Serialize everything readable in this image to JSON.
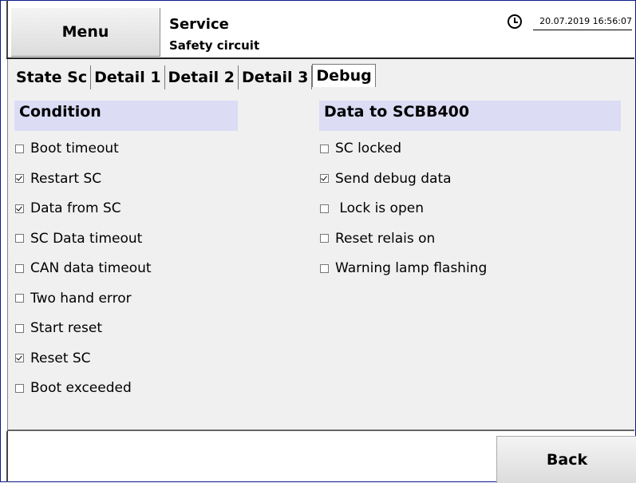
{
  "header": {
    "menu_label": "Menu",
    "title": "Service",
    "subtitle": "Safety circuit",
    "datetime": "20.07.2019   16:56:07"
  },
  "tabs": [
    {
      "label": "State Sc",
      "active": false
    },
    {
      "label": "Detail 1",
      "active": false
    },
    {
      "label": "Detail 2",
      "active": false
    },
    {
      "label": "Detail 3",
      "active": false
    },
    {
      "label": "Debug",
      "active": true
    }
  ],
  "condition": {
    "title": "Condition",
    "items": [
      {
        "label": "Boot timeout",
        "checked": false
      },
      {
        "label": "Restart SC",
        "checked": true
      },
      {
        "label": "Data from SC",
        "checked": true
      },
      {
        "label": "SC Data timeout",
        "checked": false
      },
      {
        "label": "CAN data timeout",
        "checked": false
      },
      {
        "label": "Two hand error",
        "checked": false
      },
      {
        "label": "Start reset",
        "checked": false
      },
      {
        "label": "Reset SC",
        "checked": true
      },
      {
        "label": "Boot exceeded",
        "checked": false
      }
    ]
  },
  "data_to": {
    "title": "Data to SCBB400",
    "items": [
      {
        "label": "SC locked",
        "checked": false
      },
      {
        "label": "Send debug data",
        "checked": true
      },
      {
        "label": " Lock is open",
        "checked": false
      },
      {
        "label": "Reset relais on",
        "checked": false
      },
      {
        "label": "Warning lamp flashing",
        "checked": false
      }
    ]
  },
  "footer": {
    "back_label": "Back"
  },
  "colors": {
    "frame_border": "#0b1a8c",
    "section_header_bg": "#dcdcf5",
    "panel_bg": "#f0f0f0"
  }
}
